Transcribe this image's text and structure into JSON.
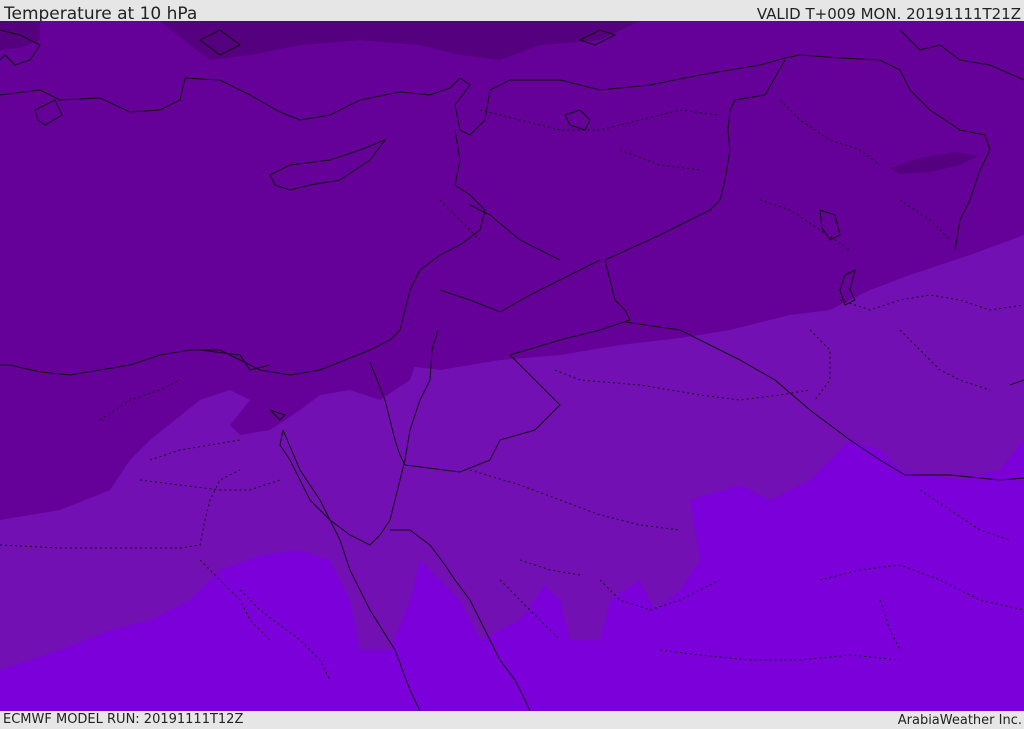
{
  "header": {
    "title": "Temperature at 10 hPa",
    "valid": "VALID T+009 MON. 20191111T21Z"
  },
  "footer": {
    "model_run": "ECMWF MODEL RUN: 20191111T12Z",
    "credit": "ArabiaWeather Inc."
  },
  "map": {
    "colors": {
      "coldest": "#55007f",
      "cold": "#650099",
      "mid": "#7310b3",
      "warm": "#7b00d9",
      "border": "#111111"
    }
  }
}
